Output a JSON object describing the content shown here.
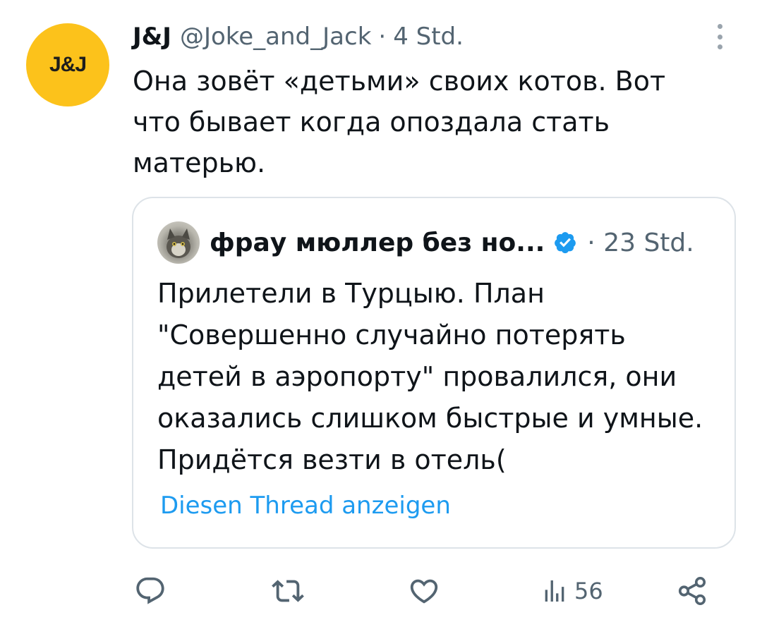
{
  "tweet": {
    "avatar_text": "J&J",
    "author_name": "J&J",
    "handle": "@Joke_and_Jack",
    "separator": "·",
    "time": "4 Std.",
    "text": "Она зовёт «детьми» своих котов. Вот что бывает когда опоздала стать матерью."
  },
  "quote": {
    "author_name": "фрау мюллер без но...",
    "separator": "·",
    "time": "23 Std.",
    "text": "Прилетели в Турцыю. План \"Совершенно случайно потерять детей в аэропорту\" провалился, они оказались слишком быстрые и умные. Придётся везти в отель(",
    "show_thread": "Diesen Thread anzeigen"
  },
  "actions": {
    "reply_icon": "reply-icon",
    "retweet_icon": "retweet-icon",
    "like_icon": "heart-icon",
    "views_icon": "views-chart-icon",
    "view_count": "56",
    "share_icon": "share-icon"
  },
  "colors": {
    "avatar_bg": "#fcc21b",
    "secondary_text": "#536471",
    "link": "#1d9bf0",
    "verified": "#1d9bf0",
    "border": "#dde3e8"
  }
}
